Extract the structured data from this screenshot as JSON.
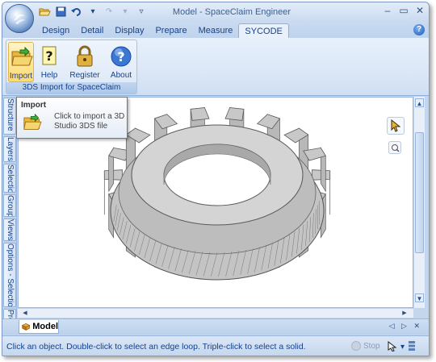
{
  "window": {
    "title": "Model - SpaceClaim Engineer"
  },
  "quick_access": {
    "icons": [
      "folder-open-icon",
      "save-icon",
      "undo-icon",
      "redo-icon",
      "customize-icon"
    ]
  },
  "tabs": [
    {
      "label": "Design"
    },
    {
      "label": "Detail"
    },
    {
      "label": "Display"
    },
    {
      "label": "Prepare"
    },
    {
      "label": "Measure"
    },
    {
      "label": "SYCODE",
      "active": true
    }
  ],
  "ribbon": {
    "group_label": "3DS Import for SpaceClaim",
    "buttons": [
      {
        "label": "Import",
        "icon": "folder-open-icon",
        "highlighted": true
      },
      {
        "label": "Help",
        "icon": "help-question-icon"
      },
      {
        "label": "Register",
        "icon": "padlock-icon"
      },
      {
        "label": "About",
        "icon": "about-icon"
      }
    ]
  },
  "tooltip": {
    "title": "Import",
    "description": "Click to import a 3D Studio 3DS file"
  },
  "left_dock": {
    "tabs": [
      "Structure",
      "Layers",
      "Selection",
      "Groups",
      "Views",
      "Options - Selection",
      "Properties"
    ]
  },
  "document_tab": {
    "label": "Model"
  },
  "status": {
    "text": "Click an object. Double-click to select an edge loop. Triple-click to select a solid.",
    "stop_label": "Stop"
  },
  "colors": {
    "accent": "#15428b",
    "gear": "#c8c8c8",
    "gear_edge": "#5a5a5a",
    "frame": "#c4d6ec"
  }
}
